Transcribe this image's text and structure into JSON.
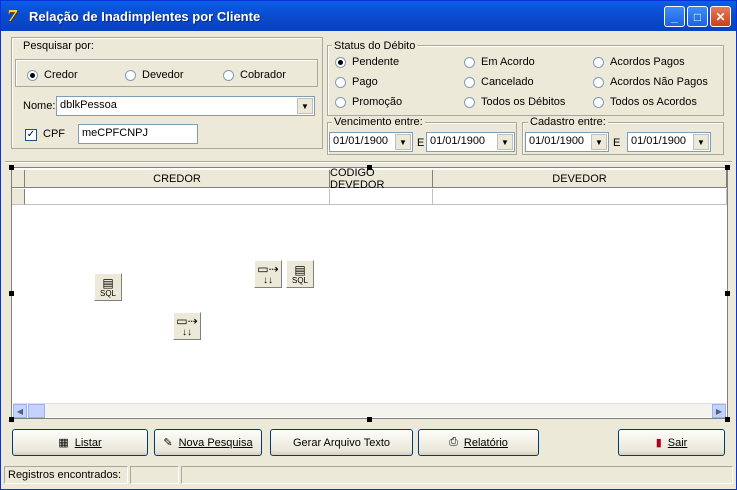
{
  "window": {
    "title": "Relação de Inadimplentes por Cliente",
    "app_icon": "7"
  },
  "titlebar_buttons": {
    "minimize": "_",
    "maximize": "□",
    "close": "✕"
  },
  "search": {
    "legend": "Pesquisar por:",
    "options": [
      {
        "label": "Credor",
        "selected": true
      },
      {
        "label": "Devedor",
        "selected": false
      },
      {
        "label": "Cobrador",
        "selected": false
      }
    ],
    "name_label": "Nome:",
    "name_value": "dblkPessoa",
    "cpf_label": "CPF",
    "cpf_checked": true,
    "cpf_value": "meCPFCNPJ"
  },
  "status": {
    "legend": "Status do Débito",
    "options": [
      {
        "label": "Pendente",
        "selected": true
      },
      {
        "label": "Em Acordo",
        "selected": false
      },
      {
        "label": "Acordos Pagos",
        "selected": false
      },
      {
        "label": "Pago",
        "selected": false
      },
      {
        "label": "Cancelado",
        "selected": false
      },
      {
        "label": "Acordos Não Pagos",
        "selected": false
      },
      {
        "label": "Promoção",
        "selected": false
      },
      {
        "label": "Todos os Débitos",
        "selected": false
      },
      {
        "label": "Todos os Acordos",
        "selected": false
      }
    ]
  },
  "vencimento": {
    "legend": "Vencimento entre:",
    "from": "01/01/1900",
    "sep": "E",
    "to": "01/01/1900"
  },
  "cadastro": {
    "legend": "Cadastro entre:",
    "from": "01/01/1900",
    "sep": "E",
    "to": "01/01/1900"
  },
  "grid": {
    "columns": [
      "CREDOR",
      "CODIGO DEVEDOR",
      "DEVEDOR"
    ]
  },
  "components": {
    "sql_label": "SQL"
  },
  "buttons": {
    "listar": "Listar",
    "nova_pesquisa": "Nova Pesquisa",
    "gerar": "Gerar Arquivo Texto",
    "relatorio": "Relatório",
    "sair": "Sair"
  },
  "statusbar": {
    "text": "Registros encontrados:"
  }
}
